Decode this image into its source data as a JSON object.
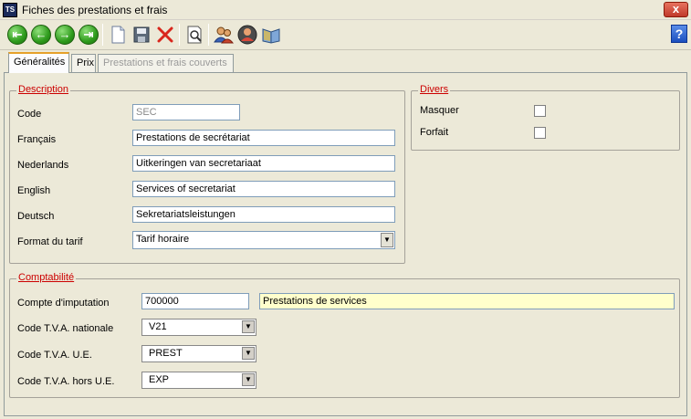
{
  "window": {
    "title": "Fiches des prestations et frais",
    "app_icon_text": "TS",
    "close_label": "x",
    "help_label": "?"
  },
  "toolbar": {
    "icons": [
      "first-icon",
      "previous-icon",
      "next-icon",
      "last-icon",
      "new-icon",
      "save-icon",
      "delete-icon",
      "preview-icon",
      "users-icon",
      "person-icon",
      "book-icon"
    ]
  },
  "tabs": [
    {
      "label": "Généralités",
      "state": "active"
    },
    {
      "label": "Prix",
      "state": "normal"
    },
    {
      "label": "Prestations et frais couverts",
      "state": "disabled"
    }
  ],
  "description": {
    "legend": "Description",
    "code_label": "Code",
    "code_value": "SEC",
    "francais_label": "Français",
    "francais_value": "Prestations de secrétariat",
    "nederlands_label": "Nederlands",
    "nederlands_value": "Uitkeringen van secretariaat",
    "english_label": "English",
    "english_value": "Services of secretariat",
    "deutsch_label": "Deutsch",
    "deutsch_value": "Sekretariatsleistungen",
    "format_label": "Format du tarif",
    "format_value": "Tarif horaire"
  },
  "divers": {
    "legend": "Divers",
    "masquer_label": "Masquer",
    "masquer_checked": false,
    "forfait_label": "Forfait",
    "forfait_checked": false
  },
  "comptabilite": {
    "legend": "Comptabilité",
    "compte_label": "Compte d'imputation",
    "compte_value": "700000",
    "compte_desc": "Prestations de services",
    "tva_nat_label": "Code T.V.A. nationale",
    "tva_nat_value": "V21",
    "tva_ue_label": "Code T.V.A. U.E.",
    "tva_ue_value": "PREST",
    "tva_hors_label": "Code T.V.A. hors U.E.",
    "tva_hors_value": "EXP"
  }
}
